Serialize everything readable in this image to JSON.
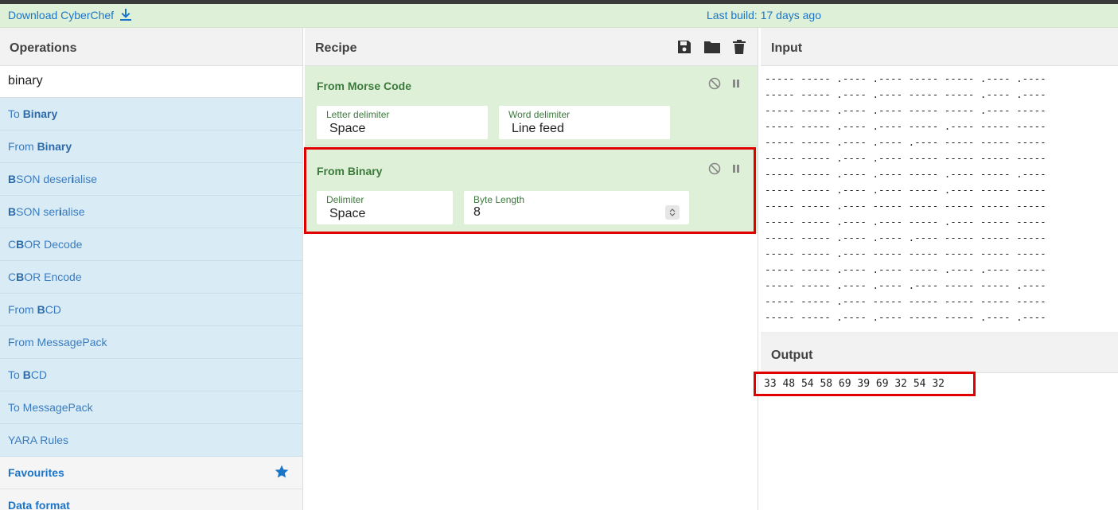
{
  "banner": {
    "download_label": "Download CyberChef",
    "last_build": "Last build: 17 days ago"
  },
  "operations": {
    "title": "Operations",
    "search_value": "binary",
    "items": [
      {
        "pre": "To ",
        "bold": "Binary",
        "post": ""
      },
      {
        "pre": "From ",
        "bold": "Binary",
        "post": ""
      },
      {
        "pre": "",
        "bold": "B",
        "post": "SON deser",
        "bold2": "i",
        "post2": "alise"
      },
      {
        "pre": "",
        "bold": "B",
        "post": "SON ser",
        "bold2": "i",
        "post2": "alise"
      },
      {
        "pre": "C",
        "bold": "B",
        "post": "OR Decode"
      },
      {
        "pre": "C",
        "bold": "B",
        "post": "OR Encode"
      },
      {
        "pre": "From ",
        "bold": "B",
        "post": "CD"
      },
      {
        "pre": "From MessagePack",
        "bold": "",
        "post": ""
      },
      {
        "pre": "To ",
        "bold": "B",
        "post": "CD"
      },
      {
        "pre": "To MessagePack",
        "bold": "",
        "post": ""
      },
      {
        "pre": "YARA Rules",
        "bold": "",
        "post": ""
      }
    ],
    "categories": [
      "Favourites",
      "Data format"
    ]
  },
  "recipe": {
    "title": "Recipe",
    "ops": [
      {
        "name": "From Morse Code",
        "fields": [
          {
            "label": "Letter delimiter",
            "value": "Space"
          },
          {
            "label": "Word delimiter",
            "value": "Line feed"
          }
        ]
      },
      {
        "name": "From Binary",
        "fields": [
          {
            "label": "Delimiter",
            "value": "Space"
          },
          {
            "label": "Byte Length",
            "value": "8"
          }
        ]
      }
    ]
  },
  "input": {
    "title": "Input",
    "lines": [
      "----- ----- .---- .---- ----- ----- .---- .----",
      "----- ----- .---- .---- ----- ----- .---- .----",
      "----- ----- .---- .---- ----- ----- .---- -----",
      "----- ----- .---- .---- ----- .---- ----- -----",
      "----- ----- .---- .---- .---- ----- ----- -----",
      "----- ----- .---- .---- ----- ----- ----- -----",
      "----- ----- .---- .---- ----- .---- ----- .----",
      "----- ----- .---- .---- ----- .---- ----- -----",
      "----- ----- .---- ----- ----- ----- ----- -----",
      "----- ----- .---- .---- ----- .---- ----- -----",
      "----- ----- .---- .---- .---- ----- ----- -----",
      "----- ----- .---- ----- ----- ----- ----- -----",
      "----- ----- .---- .---- ----- .---- .---- -----",
      "----- ----- .---- .---- .---- ----- ----- .----",
      "----- ----- .---- ----- ----- ----- ----- -----",
      "----- ----- .---- .---- ----- ----- .---- .----",
      "----- ----- .---- .---- ----- ----- ----- -----"
    ]
  },
  "output": {
    "title": "Output",
    "text": "33 48 54 58 69 39 69 32 54 32"
  },
  "colors": {
    "accent": "#1a75c9",
    "recipe_green": "#dff0d8",
    "highlight": "#e00000"
  }
}
